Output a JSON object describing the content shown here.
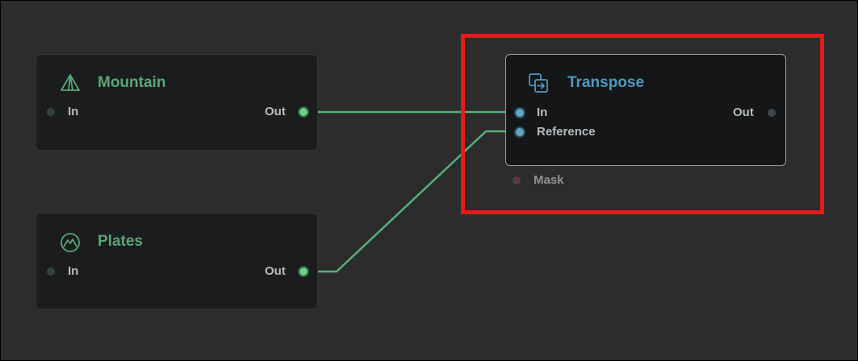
{
  "nodes": {
    "mountain": {
      "title": "Mountain",
      "in_label": "In",
      "out_label": "Out",
      "icon": "mountain-peak-icon"
    },
    "plates": {
      "title": "Plates",
      "in_label": "In",
      "out_label": "Out",
      "icon": "plates-icon"
    },
    "transpose": {
      "title": "Transpose",
      "in_label": "In",
      "reference_label": "Reference",
      "out_label": "Out",
      "mask_label": "Mask",
      "icon": "transpose-icon"
    }
  },
  "colors": {
    "background": "#2c2c2c",
    "node_fill": "#1b1c1d",
    "green_accent": "#5aa676",
    "blue_accent": "#4f9ac0",
    "wire": "#55b07a",
    "highlight": "#e31b1b"
  }
}
